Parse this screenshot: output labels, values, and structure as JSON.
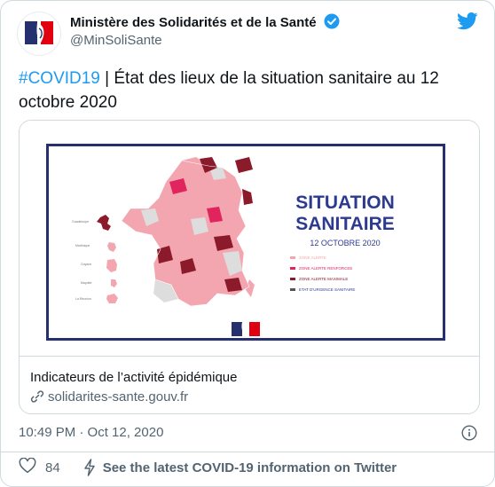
{
  "author": {
    "name": "Ministère des Solidarités et de la Santé",
    "handle": "@MinSoliSante"
  },
  "tweet": {
    "hashtag": "#COVID19",
    "text": " | État des lieux de la situation sanitaire au 12 octobre 2020",
    "timestamp": "10:49 PM · Oct 12, 2020",
    "likes": "84",
    "covid_info": "See the latest COVID-19 information on Twitter"
  },
  "card": {
    "title": "Indicateurs de l’activité épidémique",
    "domain": "solidarites-sante.gouv.fr",
    "image": {
      "headline_1": "SITUATION",
      "headline_2": "SANITAIRE",
      "date": "12 OCTOBRE 2020",
      "legend": [
        {
          "label": "ZONE ALERTE",
          "color": "#f4a6b0"
        },
        {
          "label": "ZONE ALERTE RENFORCEE",
          "color": "#e0245e"
        },
        {
          "label": "ZONE ALERTE MAXIMALE",
          "color": "#8b1a2b"
        },
        {
          "label": "ETAT D’URGENCE SANITAIRE",
          "color": "#555555"
        }
      ],
      "overseas": [
        "Guadeloupe",
        "Martinique",
        "Guyane",
        "Mayotte",
        "La Réunion"
      ]
    }
  },
  "colors": {
    "accent": "#1d9bf0",
    "navy": "#27306e",
    "headline": "#2c3b8f",
    "alert_light": "#f4a6b0",
    "alert_red": "#e0245e",
    "alert_dark": "#8b1a2b"
  }
}
